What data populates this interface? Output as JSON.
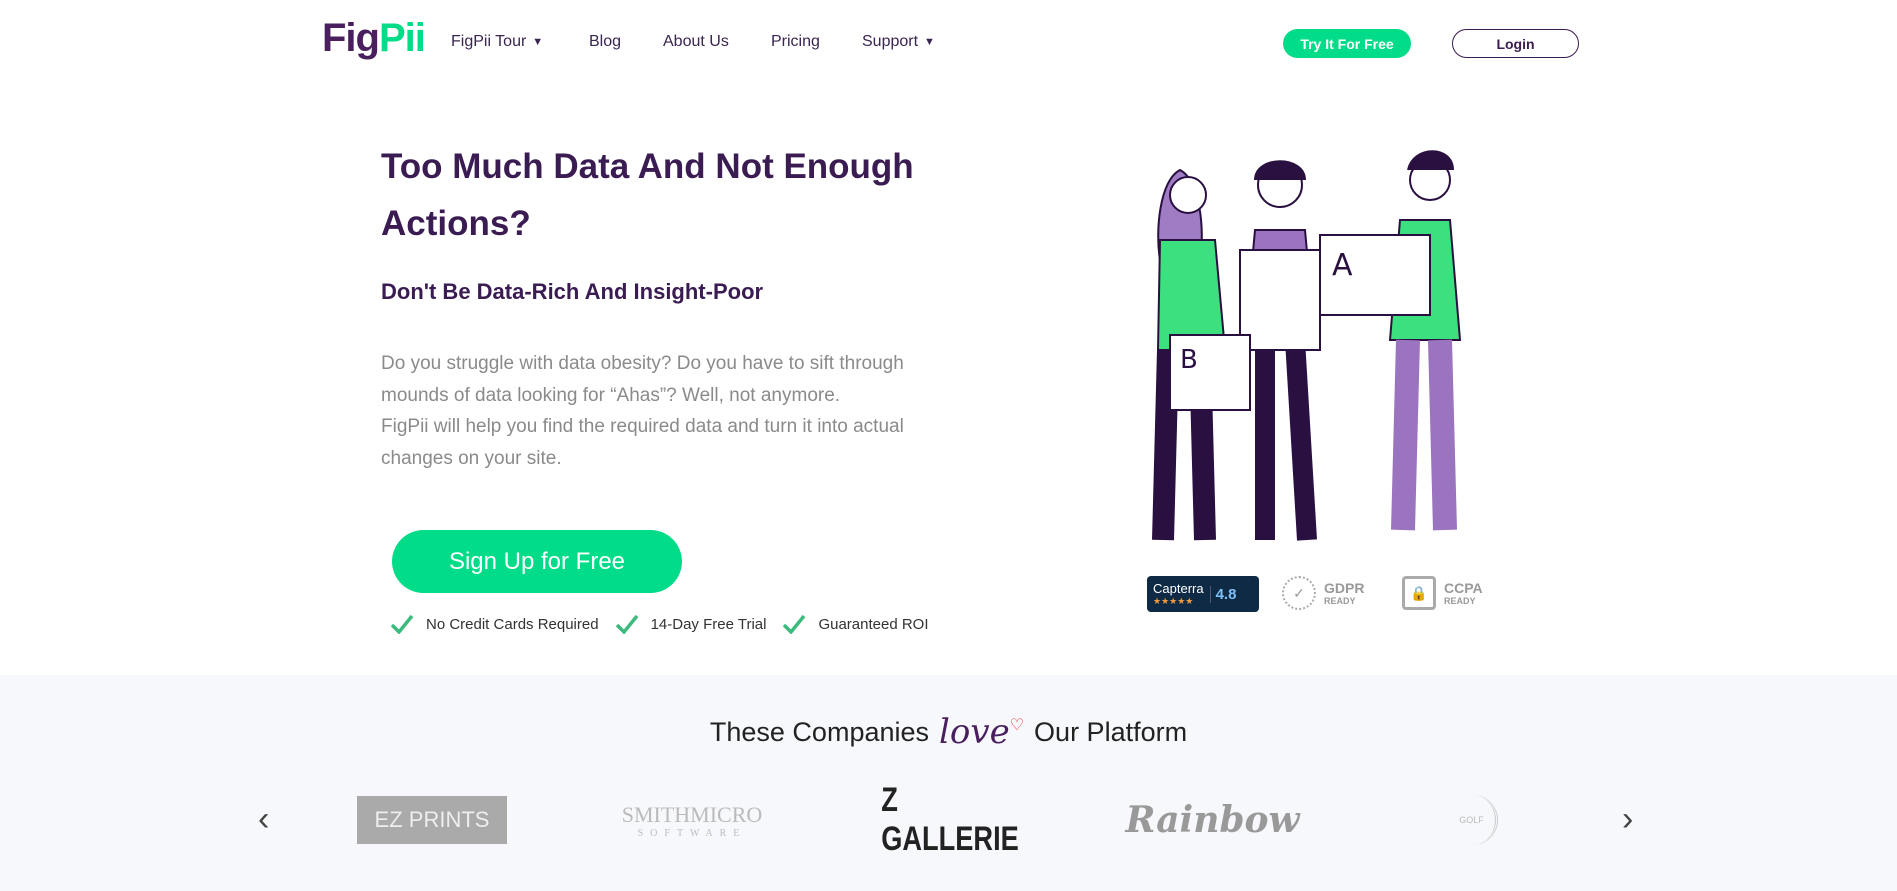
{
  "brand": {
    "part1": "Fig",
    "part2": "Pii",
    "green": "#00dc87",
    "purple": "#3a1c52"
  },
  "nav": {
    "items": [
      {
        "label": "FigPii Tour",
        "dropdown": true
      },
      {
        "label": "Blog"
      },
      {
        "label": "About Us"
      },
      {
        "label": "Pricing"
      },
      {
        "label": "Support",
        "dropdown": true
      }
    ],
    "try_label": "Try It For Free",
    "login_label": "Login"
  },
  "hero": {
    "title": "Too Much Data And Not Enough Actions?",
    "subtitle": "Don't Be Data-Rich And Insight-Poor",
    "para1": "Do you struggle with data obesity? Do you have to sift through mounds of data looking for “Ahas”? Well, not anymore.",
    "para2": "FigPii will help you find the required data and turn it into actual changes on your site.",
    "cta": "Sign Up for Free",
    "checks": [
      "No Credit Cards Required",
      "14-Day Free Trial",
      "Guaranteed ROI"
    ]
  },
  "badges": {
    "capterra": "Capterra",
    "capterra_score": "4.8",
    "gdpr": "GDPR",
    "gdpr_sub": "READY",
    "ccpa": "CCPA",
    "ccpa_sub": "READY"
  },
  "companies": {
    "heading_pre": "These Companies",
    "heading_love": "love",
    "heading_post": "Our Platform",
    "logos": [
      "EZ PRINTS",
      "SMITHMICRO",
      "SOFTWARE",
      "Z GALLERIE",
      "Rainbow",
      "GOLF"
    ]
  }
}
